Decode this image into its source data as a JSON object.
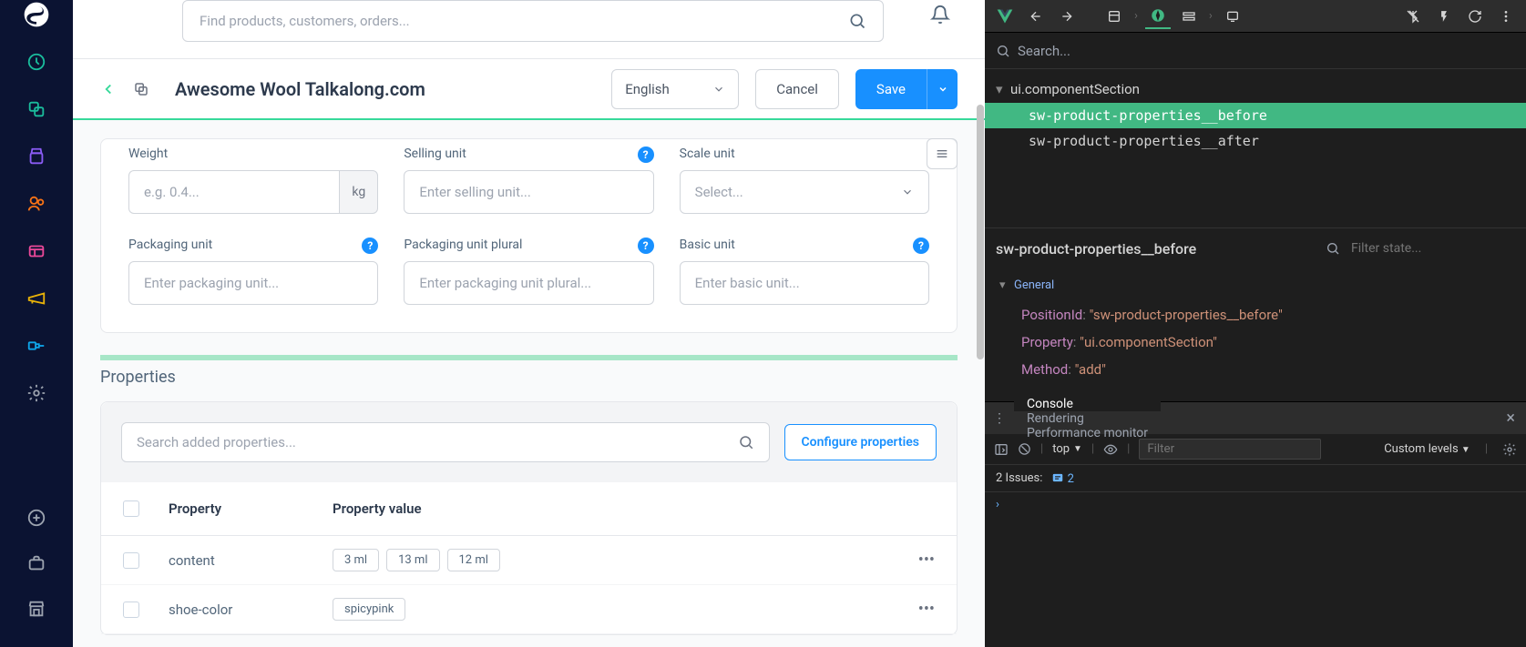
{
  "global_search": {
    "placeholder": "Find products, customers, orders..."
  },
  "page": {
    "title": "Awesome Wool Talkalong.com",
    "language": "English",
    "cancel": "Cancel",
    "save": "Save"
  },
  "measures": {
    "weight": {
      "label": "Weight",
      "placeholder": "e.g. 0.4...",
      "unit": "kg"
    },
    "selling_unit": {
      "label": "Selling unit",
      "placeholder": "Enter selling unit..."
    },
    "scale_unit": {
      "label": "Scale unit",
      "placeholder": "Select..."
    },
    "packaging_unit": {
      "label": "Packaging unit",
      "placeholder": "Enter packaging unit..."
    },
    "packaging_unit_plural": {
      "label": "Packaging unit plural",
      "placeholder": "Enter packaging unit plural..."
    },
    "basic_unit": {
      "label": "Basic unit",
      "placeholder": "Enter basic unit..."
    }
  },
  "properties": {
    "title": "Properties",
    "search_placeholder": "Search added properties...",
    "configure": "Configure properties",
    "col_property": "Property",
    "col_value": "Property value",
    "rows": [
      {
        "name": "content",
        "values": [
          "3 ml",
          "13 ml",
          "12 ml"
        ]
      },
      {
        "name": "shoe-color",
        "values": [
          "spicypink"
        ]
      }
    ]
  },
  "devtools": {
    "search_placeholder": "Search...",
    "tree_root": "ui.componentSection",
    "tree_items": [
      "sw-product-properties__before",
      "sw-product-properties__after"
    ],
    "selected": "sw-product-properties__before",
    "filter_placeholder": "Filter state...",
    "section": "General",
    "props": [
      {
        "k": "PositionId",
        "v": "\"sw-product-properties__before\""
      },
      {
        "k": "Property",
        "v": "\"ui.componentSection\""
      },
      {
        "k": "Method",
        "v": "\"add\""
      }
    ],
    "console_tabs": [
      "Console",
      "Rendering",
      "Performance monitor"
    ],
    "context": "top",
    "filter": "Filter",
    "levels": "Custom levels",
    "issues_label": "2 Issues:",
    "issues_count": "2"
  }
}
